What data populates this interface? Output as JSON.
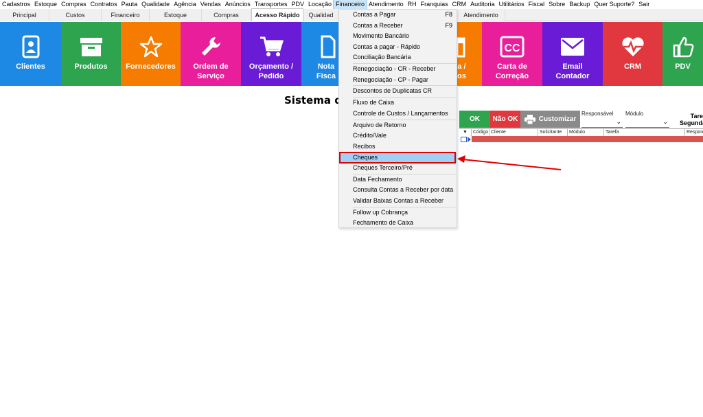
{
  "menubar": {
    "items": [
      "Cadastros",
      "Estoque",
      "Compras",
      "Contratos",
      "Pauta",
      "Qualidade",
      "Agência",
      "Vendas",
      "Anúncios",
      "Transportes",
      "PDV",
      "Locação",
      "Financeiro",
      "Atendimento",
      "RH",
      "Franquias",
      "CRM",
      "Auditoria",
      "Utilitários",
      "Fiscal",
      "Sobre",
      "Backup",
      "Quer Suporte?",
      "Sair"
    ],
    "active": "Financeiro"
  },
  "tabs": [
    "Principal",
    "Custos",
    "Financeiro",
    "Estoque",
    "Compras",
    "Acesso Rápido",
    "Qualidad",
    "Atendimento"
  ],
  "tiles": [
    {
      "label": "Clientes",
      "icon": "client-card-icon",
      "color": "#1e88e5"
    },
    {
      "label": "Produtos",
      "icon": "box-icon",
      "color": "#2ea44f"
    },
    {
      "label": "Fornecedores",
      "icon": "star-icon",
      "color": "#f57c00"
    },
    {
      "label": "Ordem de\nServiço",
      "icon": "wrench-icon",
      "color": "#e91e9a"
    },
    {
      "label": "Orçamento /\nPedido",
      "icon": "cart-icon",
      "color": "#6a1bd6"
    },
    {
      "label": "Nota\nFisca",
      "icon": "document-icon",
      "color": "#1e88e5"
    },
    {
      "label": "a /\nos",
      "icon": "calendar-icon",
      "color": "#f57c00"
    },
    {
      "label": "Carta de\nCorreção",
      "icon": "cc-icon",
      "color": "#e91e9a"
    },
    {
      "label": "Email\nContador",
      "icon": "envelope-icon",
      "color": "#6a1bd6"
    },
    {
      "label": "CRM",
      "icon": "heart-pulse-icon",
      "color": "#e0383e"
    },
    {
      "label": "PDV",
      "icon": "thumbs-up-icon",
      "color": "#2ea44f"
    }
  ],
  "page_title": "Sistema de",
  "toolbar": {
    "ok_label": "OK",
    "not_ok_label": "Não OK",
    "customize_label": "Customizar",
    "responsavel_label": "Responsável",
    "modulo_label": "Módulo",
    "tarefa_label": "Tare",
    "segunda_label": "Segunda"
  },
  "grid": {
    "sort_glyph": "▼",
    "columns": [
      "Código",
      "Cliente",
      "Solicitante",
      "Módulo",
      "Tarefa",
      "Respons"
    ]
  },
  "dropdown": {
    "items": [
      {
        "label": "Contas a Pagar",
        "shortcut": "F8"
      },
      {
        "label": "Contas a Receber",
        "shortcut": "F9"
      },
      {
        "label": "Movimento Bancário",
        "shortcut": ""
      },
      {
        "label": "Contas a pagar - Rápido",
        "shortcut": ""
      },
      {
        "label": "Conciliação Bancária",
        "shortcut": ""
      },
      {
        "label": "Renegociação - CR - Receber",
        "shortcut": ""
      },
      {
        "label": "Renegociação - CP - Pagar",
        "shortcut": ""
      },
      {
        "label": "Descontos de Duplicatas CR",
        "shortcut": ""
      },
      {
        "label": "Fluxo de Caixa",
        "shortcut": ""
      },
      {
        "label": "Controle de Custos / Lançamentos",
        "shortcut": ""
      },
      {
        "label": "Arquivo de Retorno",
        "shortcut": ""
      },
      {
        "label": "Crédito/Vale",
        "shortcut": ""
      },
      {
        "label": "Recibos",
        "shortcut": ""
      },
      {
        "label": "Cheques",
        "shortcut": ""
      },
      {
        "label": "Cheques Terceiro/Pré",
        "shortcut": ""
      },
      {
        "label": "Data Fechamento",
        "shortcut": ""
      },
      {
        "label": "Consulta Contas a Receber por data",
        "shortcut": ""
      },
      {
        "label": "Validar Baixas Contas a Receber",
        "shortcut": ""
      },
      {
        "label": "Follow up Cobrança",
        "shortcut": ""
      },
      {
        "label": "Fechamento de Caixa",
        "shortcut": ""
      }
    ],
    "highlighted": "Cheques"
  },
  "colors": {
    "ok": "#2ea44f",
    "not_ok": "#e0383e",
    "customize": "#8a8a8a",
    "highlight": "#9fd0f5",
    "annotation": "#e00000"
  }
}
